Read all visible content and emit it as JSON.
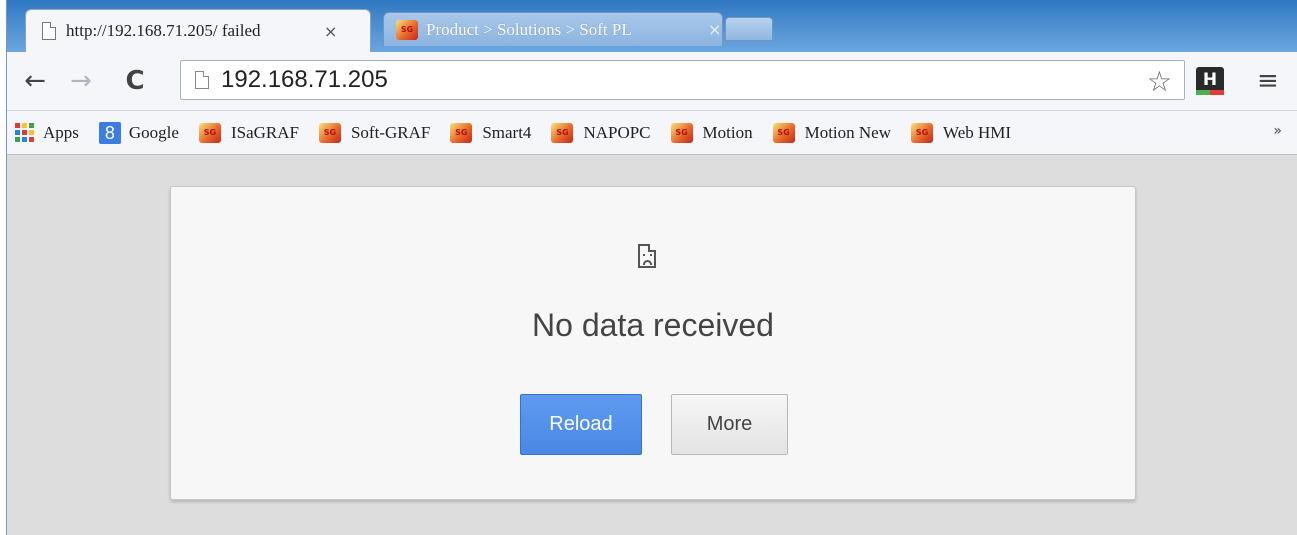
{
  "tabs": [
    {
      "title": "http://192.168.71.205/ failed",
      "close": "×",
      "active": true,
      "icon": "page-icon"
    },
    {
      "title": "Product > Solutions > Soft PL",
      "close": "×",
      "active": false,
      "icon": "softgraf-favicon"
    }
  ],
  "toolbar": {
    "back": "←",
    "forward": "→",
    "reload": "C",
    "url": "192.168.71.205",
    "star": "☆",
    "extension_label": "H",
    "menu": "≡"
  },
  "bookmarks": [
    {
      "label": "Apps",
      "icon": "apps-grid-icon"
    },
    {
      "label": "Google",
      "icon": "google-icon"
    },
    {
      "label": "ISaGRAF",
      "icon": "softgraf-favicon"
    },
    {
      "label": "Soft-GRAF",
      "icon": "softgraf-favicon"
    },
    {
      "label": "Smart4",
      "icon": "softgraf-favicon"
    },
    {
      "label": "NAPOPC",
      "icon": "softgraf-favicon"
    },
    {
      "label": "Motion",
      "icon": "softgraf-favicon"
    },
    {
      "label": "Motion New",
      "icon": "softgraf-favicon"
    },
    {
      "label": "Web HMI",
      "icon": "softgraf-favicon"
    }
  ],
  "bookmarks_overflow": "»",
  "error_page": {
    "icon": "sad-page-icon",
    "heading": "No data received",
    "reload_label": "Reload",
    "more_label": "More"
  },
  "colors": {
    "tabstrip": "#3f86cc",
    "primary_button": "#4d8ae8",
    "page_background": "#dddddd"
  }
}
